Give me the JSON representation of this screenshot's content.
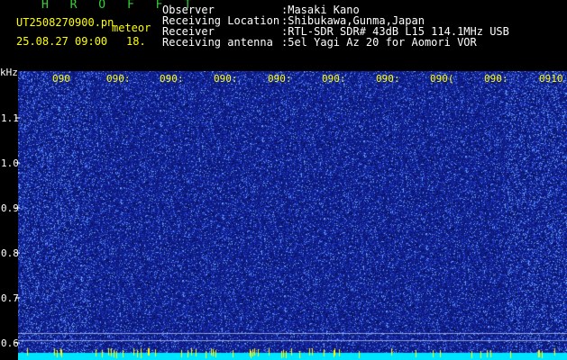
{
  "header": {
    "station": "H R O F F T",
    "filename": "UT2508270900.pn",
    "meteor_label": "meteor",
    "date_time": "25.08.27 09:00",
    "count": "18.",
    "observer_label": "Observer",
    "observer_value": ":Masaki Kano",
    "location_label": "Receiving Location",
    "location_value": ":Shibukawa,Gunma,Japan",
    "receiver_label": "Receiver",
    "receiver_value": ":RTL-SDR SDR# 43dB L15 114.1MHz USB",
    "antenna_label": "Receiving antenna",
    "antenna_value": ":5el Yagi Az 20 for Aomori VOR"
  },
  "axis": {
    "unit": "kHz",
    "y_ticks": [
      "1.1",
      "1.0",
      "0.9",
      "0.8",
      "0.7",
      "0.6"
    ],
    "x_ticks": [
      "090",
      "090:",
      "090:",
      "090:",
      "090:",
      "090:",
      "090:",
      "090(",
      "090:",
      "0910"
    ]
  },
  "colors": {
    "background": "#000000",
    "spectrum_base": "#10208a",
    "noise_light": "#6fa8ff",
    "baseline": "#00ffff",
    "tick": "#ffff00"
  }
}
